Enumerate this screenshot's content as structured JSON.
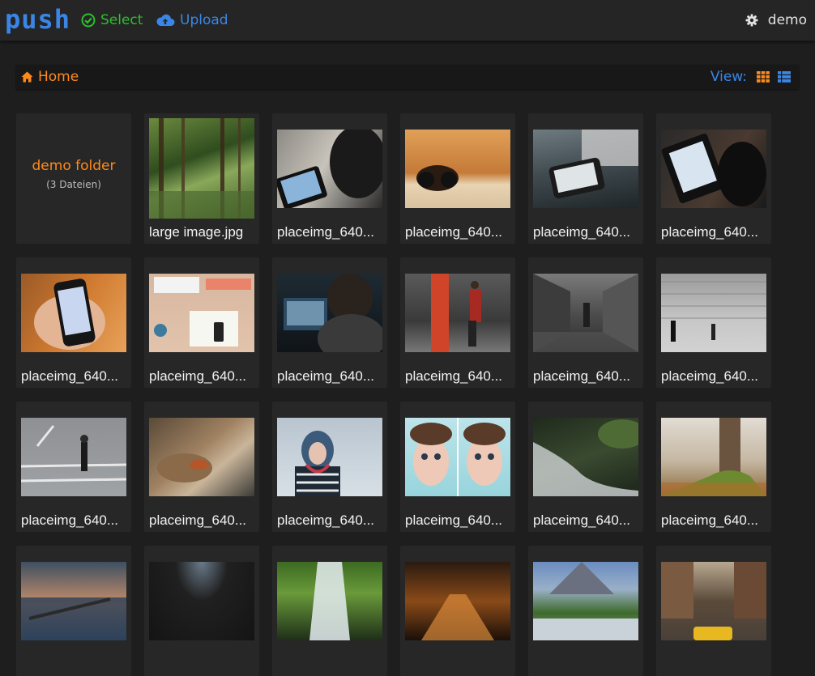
{
  "app": {
    "logo": "push",
    "select_label": "Select",
    "upload_label": "Upload",
    "user_name": "demo",
    "colors": {
      "accent_blue": "#3a86e6",
      "accent_green": "#2dbf2d",
      "accent_orange": "#ff8a1c",
      "background": "#1e1e1e"
    }
  },
  "breadcrumb": {
    "home_label": "Home",
    "home_icon": "home-icon"
  },
  "view": {
    "label": "View:",
    "grid_icon": "grid-view-icon",
    "list_icon": "list-view-icon"
  },
  "folder": {
    "name": "demo folder",
    "count_text": "(3 Dateien)"
  },
  "files": [
    {
      "name": "large image.jpg",
      "thumb": "forest"
    },
    {
      "name": "placeimg_640...",
      "thumb": "tablet"
    },
    {
      "name": "placeimg_640...",
      "thumb": "headphones"
    },
    {
      "name": "placeimg_640...",
      "thumb": "phone-keyboard"
    },
    {
      "name": "placeimg_640...",
      "thumb": "ereader"
    },
    {
      "name": "placeimg_640...",
      "thumb": "hand-phone"
    },
    {
      "name": "placeimg_640...",
      "thumb": "desk"
    },
    {
      "name": "placeimg_640...",
      "thumb": "laptop-person"
    },
    {
      "name": "placeimg_640...",
      "thumb": "street"
    },
    {
      "name": "placeimg_640...",
      "thumb": "corridor"
    },
    {
      "name": "placeimg_640...",
      "thumb": "wall"
    },
    {
      "name": "placeimg_640...",
      "thumb": "crossing"
    },
    {
      "name": "placeimg_640...",
      "thumb": "rocks"
    },
    {
      "name": "placeimg_640...",
      "thumb": "scarf-woman"
    },
    {
      "name": "placeimg_640...",
      "thumb": "twins"
    },
    {
      "name": "placeimg_640...",
      "thumb": "stream"
    },
    {
      "name": "placeimg_640...",
      "thumb": "tree"
    },
    {
      "name": "",
      "thumb": "pier"
    },
    {
      "name": "",
      "thumb": "dark"
    },
    {
      "name": "",
      "thumb": "waterfall"
    },
    {
      "name": "",
      "thumb": "lantern-path"
    },
    {
      "name": "",
      "thumb": "mountain-river"
    },
    {
      "name": "",
      "thumb": "city-taxi"
    }
  ]
}
